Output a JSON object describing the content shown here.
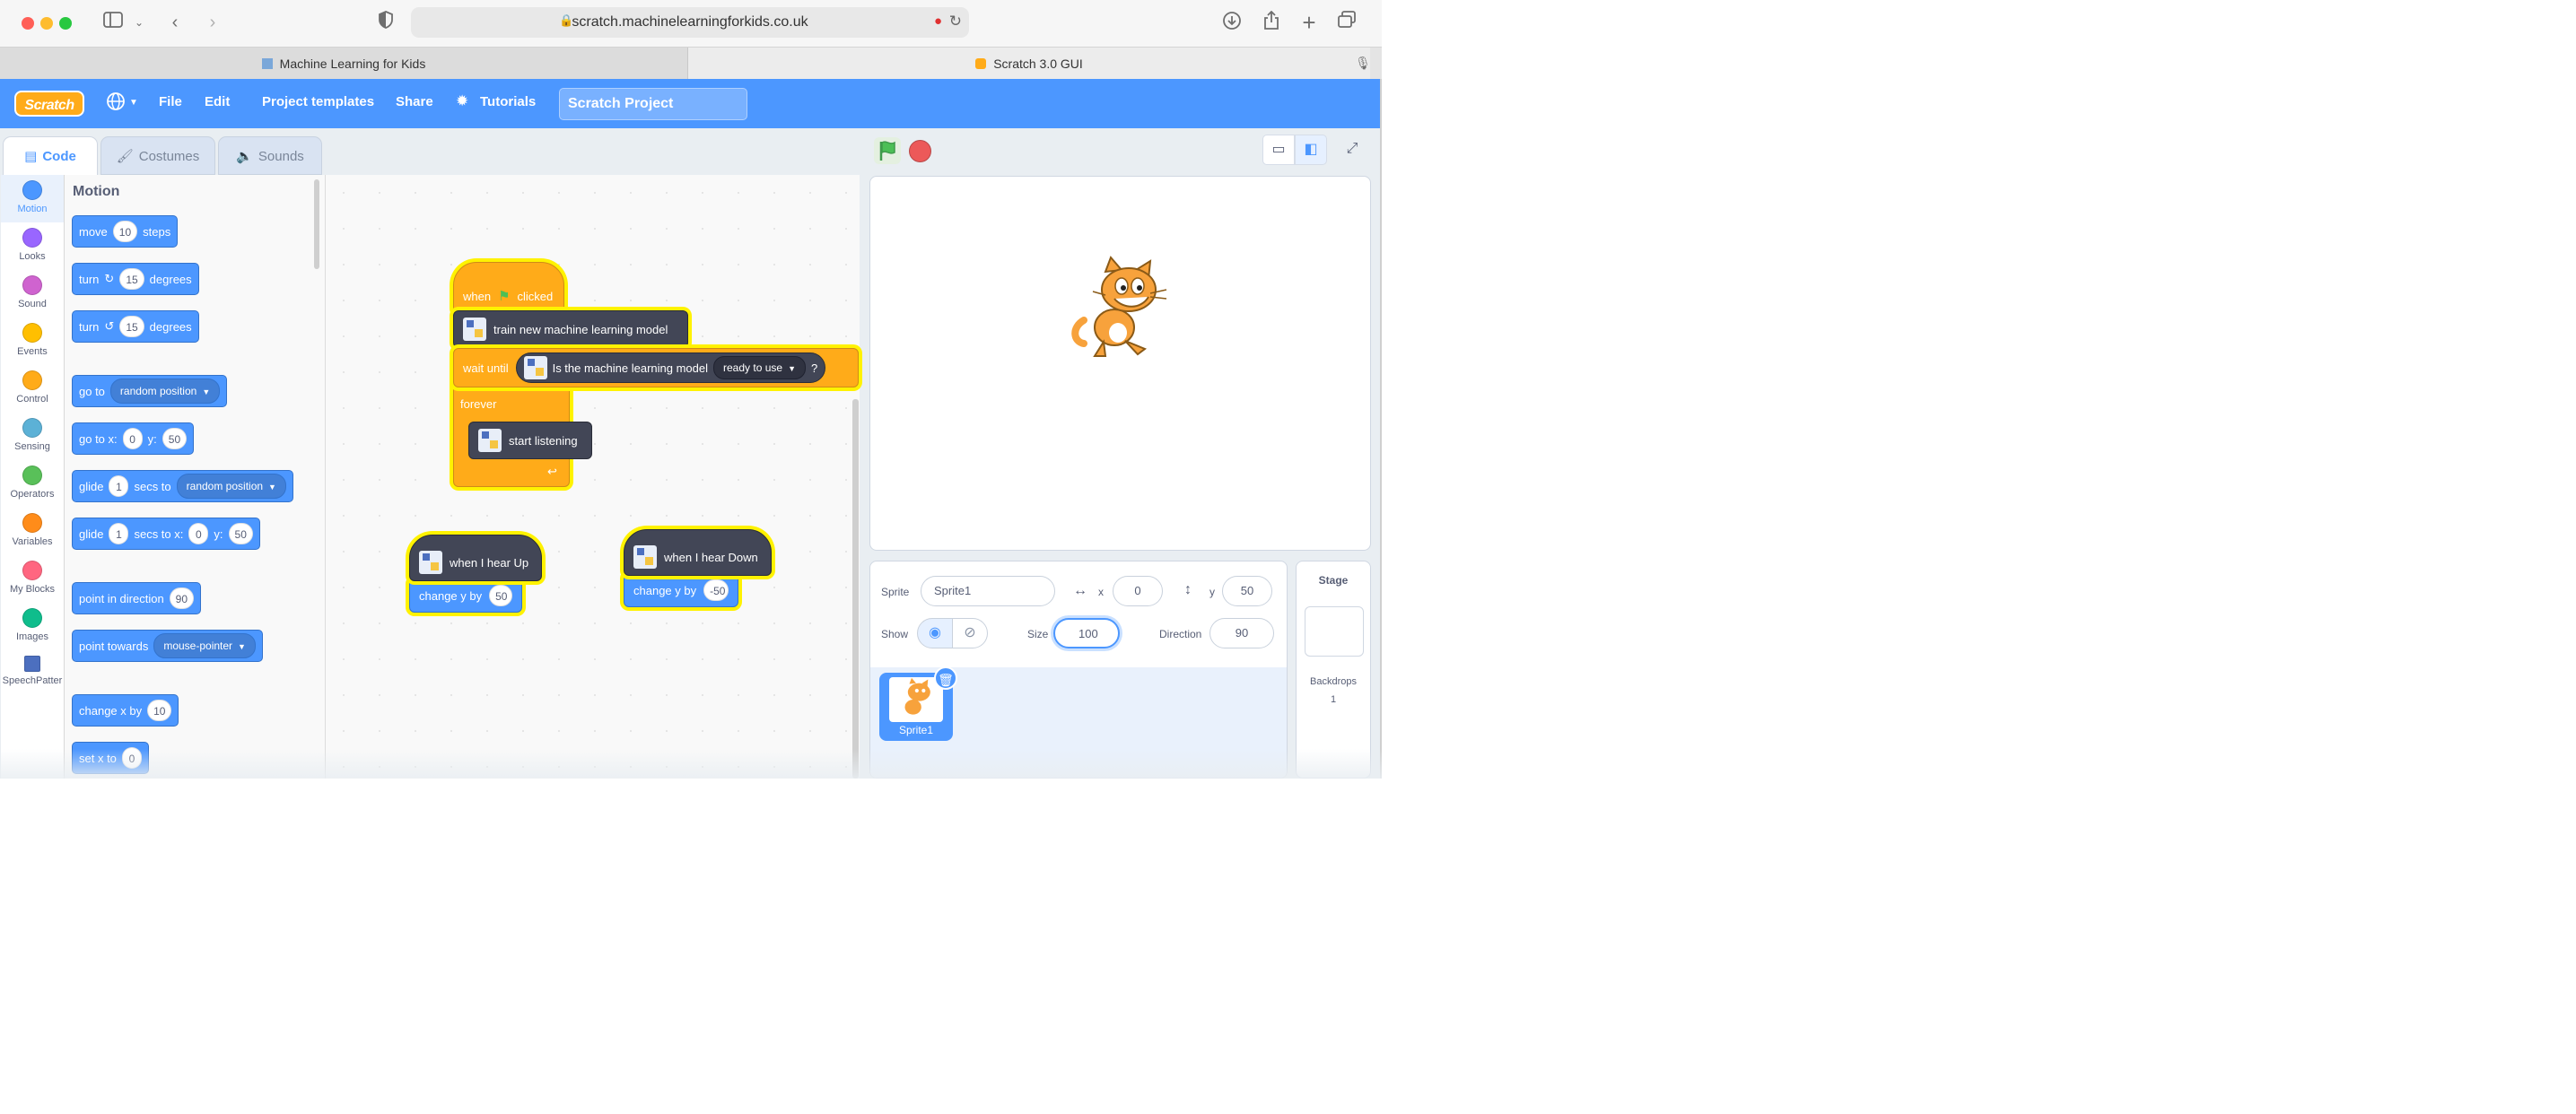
{
  "browser": {
    "url": "scratch.machinelearningforkids.co.uk",
    "tabs": [
      {
        "label": "Machine Learning for Kids"
      },
      {
        "label": "Scratch 3.0 GUI"
      }
    ]
  },
  "menubar": {
    "logo": "Scratch",
    "file": "File",
    "edit": "Edit",
    "templates": "Project templates",
    "share": "Share",
    "tutorials": "Tutorials",
    "project_title": "Scratch Project"
  },
  "editor_tabs": {
    "code": "Code",
    "costumes": "Costumes",
    "sounds": "Sounds"
  },
  "categories": [
    {
      "label": "Motion",
      "color": "#4c97ff"
    },
    {
      "label": "Looks",
      "color": "#9966ff"
    },
    {
      "label": "Sound",
      "color": "#cf63cf"
    },
    {
      "label": "Events",
      "color": "#ffbf00"
    },
    {
      "label": "Control",
      "color": "#ffab19"
    },
    {
      "label": "Sensing",
      "color": "#5cb1d6"
    },
    {
      "label": "Operators",
      "color": "#59c059"
    },
    {
      "label": "Variables",
      "color": "#ff8c1a"
    },
    {
      "label": "My Blocks",
      "color": "#ff6680"
    },
    {
      "label": "Images",
      "color": "#0fbd8c"
    },
    {
      "label": "SpeechPatter",
      "color": "#4c6fbf"
    }
  ],
  "flyout": {
    "heading": "Motion",
    "move": {
      "a": "move",
      "v": "10",
      "b": "steps"
    },
    "turn_right": {
      "a": "turn",
      "v": "15",
      "b": "degrees"
    },
    "turn_left": {
      "a": "turn",
      "v": "15",
      "b": "degrees"
    },
    "go_to": {
      "a": "go to",
      "dd": "random position"
    },
    "go_to_xy": {
      "a": "go to x:",
      "x": "0",
      "b": "y:",
      "y": "50"
    },
    "glide_to": {
      "a": "glide",
      "v": "1",
      "b": "secs to",
      "dd": "random position"
    },
    "glide_xy": {
      "a": "glide",
      "v": "1",
      "b": "secs to x:",
      "x": "0",
      "c": "y:",
      "y": "50"
    },
    "point_dir": {
      "a": "point in direction",
      "v": "90"
    },
    "point_towards": {
      "a": "point towards",
      "dd": "mouse-pointer"
    },
    "change_x": {
      "a": "change x by",
      "v": "10"
    },
    "set_x": {
      "a": "set x to",
      "v": "0"
    }
  },
  "workspace": {
    "when_clicked_a": "when",
    "when_clicked_b": "clicked",
    "train": "train new machine learning model",
    "wait_until": "wait until",
    "is_ready": "Is the machine learning model",
    "ready_dd": "ready to use",
    "question": "?",
    "forever": "forever",
    "start_listening": "start listening",
    "hear_up": "when I hear Up",
    "change_y_up": "change y by",
    "up_value": "50",
    "hear_down": "when I hear Down",
    "change_y_down": "change y by",
    "down_value": "-50"
  },
  "sprite_info": {
    "sprite_label": "Sprite",
    "sprite_name": "Sprite1",
    "x_label": "x",
    "x_value": "0",
    "y_label": "y",
    "y_value": "50",
    "show_label": "Show",
    "size_label": "Size",
    "size_value": "100",
    "direction_label": "Direction",
    "direction_value": "90"
  },
  "sprite_list": [
    {
      "name": "Sprite1"
    }
  ],
  "stage_panel": {
    "title": "Stage",
    "backdrops_label": "Backdrops",
    "backdrops_count": "1"
  }
}
